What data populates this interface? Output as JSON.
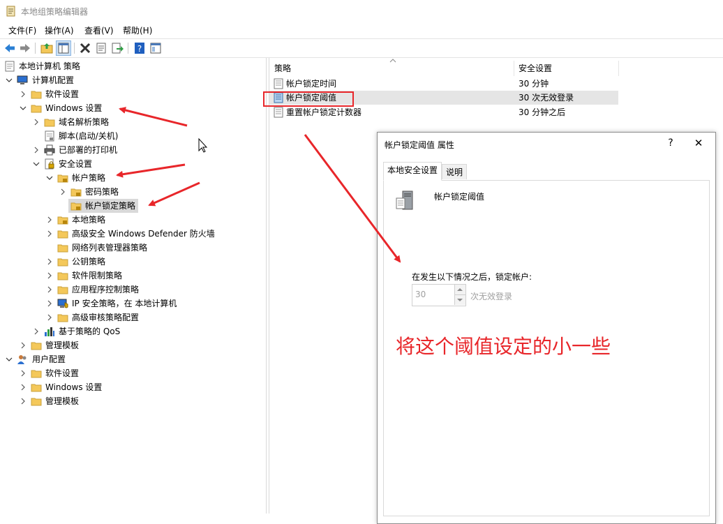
{
  "window": {
    "title": "本地组策略编辑器"
  },
  "menubar": {
    "items": [
      "文件(F)",
      "操作(A)",
      "查看(V)",
      "帮助(H)"
    ]
  },
  "toolbar": {
    "icons": [
      "back-arrow-icon",
      "forward-arrow-icon",
      "up-folder-icon",
      "show-tree-icon",
      "delete-icon",
      "properties-icon",
      "export-icon",
      "help-icon",
      "extended-view-icon"
    ]
  },
  "tree": {
    "root": "本地计算机 策略",
    "computer_config": "计算机配置",
    "software_settings": "软件设置",
    "windows_settings": "Windows 设置",
    "dns_policy": "域名解析策略",
    "scripts": "脚本(启动/关机)",
    "printers": "已部署的打印机",
    "security_settings": "安全设置",
    "account_policies": "帐户策略",
    "password_policy": "密码策略",
    "lockout_policy": "帐户锁定策略",
    "local_policies": "本地策略",
    "firewall": "高级安全 Windows Defender 防火墙",
    "network_list": "网络列表管理器策略",
    "public_key": "公钥策略",
    "software_restriction": "软件限制策略",
    "app_control": "应用程序控制策略",
    "ip_security": "IP 安全策略，在 本地计算机",
    "audit_policy": "高级审核策略配置",
    "qos": "基于策略的 QoS",
    "admin_templates": "管理模板",
    "user_config": "用户配置",
    "user_software": "软件设置",
    "user_windows": "Windows 设置",
    "user_admin_templates": "管理模板"
  },
  "list": {
    "columns": [
      "策略",
      "安全设置"
    ],
    "rows": [
      {
        "policy": "帐户锁定时间",
        "setting": "30 分钟"
      },
      {
        "policy": "帐户锁定阈值",
        "setting": "30 次无效登录"
      },
      {
        "policy": "重置帐户锁定计数器",
        "setting": "30 分钟之后"
      }
    ]
  },
  "dialog": {
    "title": "帐户锁定阈值 属性",
    "help_btn": "?",
    "close_btn": "✕",
    "tabs": [
      "本地安全设置",
      "说明"
    ],
    "policy_name": "帐户锁定阈值",
    "prompt": "在发生以下情况之后，锁定帐户:",
    "value": "30",
    "unit": "次无效登录"
  },
  "annotation": {
    "text": "将这个阈值设定的小一些",
    "color": "#e8262a"
  },
  "colors": {
    "selection": "#d9d9d9",
    "highlight_row": "#e5e5e5",
    "folder": "#f4c85a",
    "annotation": "#e8262a"
  }
}
